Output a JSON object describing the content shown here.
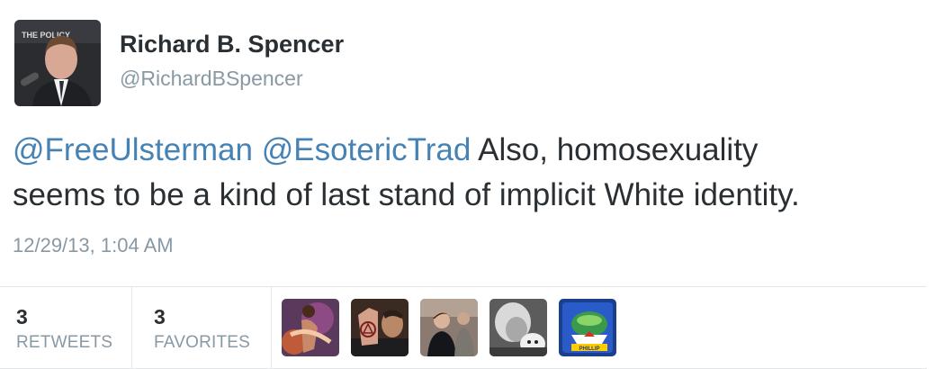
{
  "author": {
    "name": "Richard B. Spencer",
    "handle": "@RichardBSpencer",
    "avatar_banner_text": "THE POLICY"
  },
  "tweet": {
    "mention_1": "@FreeUlsterman",
    "mention_2": "@EsotericTrad",
    "text_line_1": "Also, homosexuality",
    "text_line_2": "seems to be a kind of last stand of implicit White identity.",
    "timestamp": "12/29/13, 1:04 AM"
  },
  "stats": {
    "retweets": {
      "count": "3",
      "label": "RETWEETS"
    },
    "favorites": {
      "count": "3",
      "label": "FAVORITES"
    }
  },
  "favoriters": [
    {
      "icon": "favoriter-avatar-icon"
    },
    {
      "icon": "favoriter-avatar-icon"
    },
    {
      "icon": "favoriter-avatar-icon"
    },
    {
      "icon": "favoriter-avatar-icon"
    },
    {
      "icon": "favoriter-avatar-icon",
      "badge_text": "PHILLIP"
    }
  ],
  "colors": {
    "mention": "#4682b4",
    "secondary_text": "#8899a6",
    "primary_text": "#292f33",
    "divider": "#e1e8ed"
  }
}
